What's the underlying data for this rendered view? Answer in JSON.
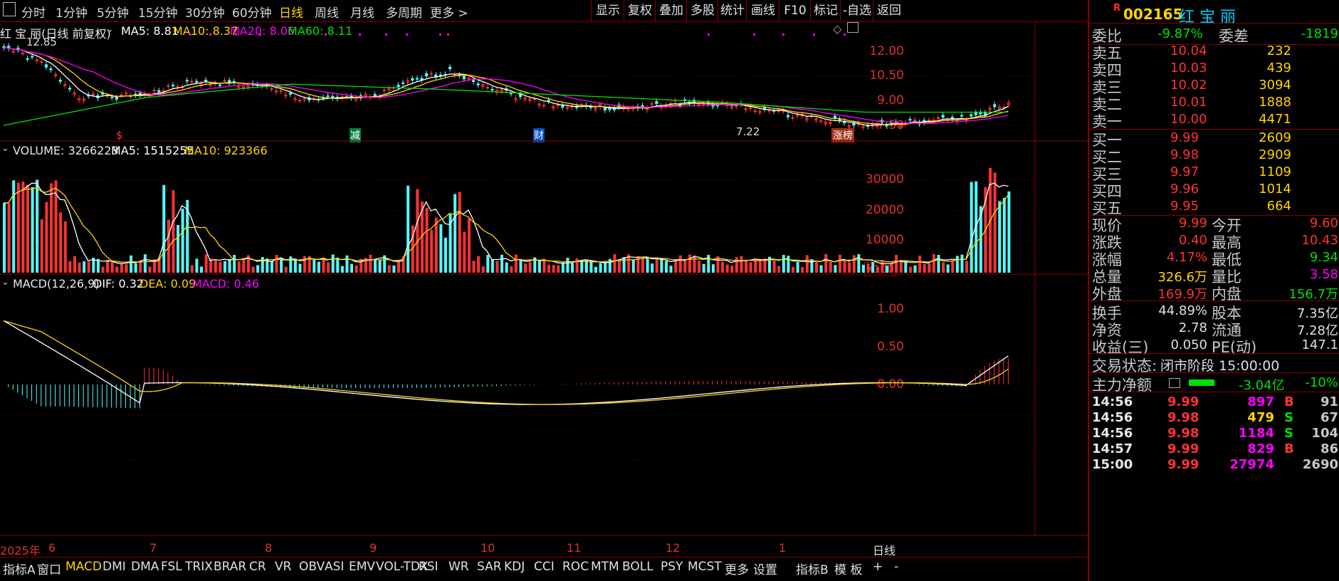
{
  "toolbar": {
    "icon": "panel-icon",
    "periods": [
      "分时",
      "1分钟",
      "5分钟",
      "15分钟",
      "30分钟",
      "60分钟",
      "日线",
      "周线",
      "月线",
      "多周期",
      "更多 >"
    ],
    "active_period": "日线",
    "right_buttons": [
      "显示",
      "复权",
      "叠加",
      "多股",
      "统计",
      "画线",
      "F10",
      "标记",
      "-自选",
      "返回"
    ]
  },
  "main_chart": {
    "stock_title": "红 宝 丽(日线 前复权)",
    "ma5": "MA5: 8.81",
    "ma10": "MA10: 8.37",
    "ma20": "MA20: 8.06",
    "ma60": "MA60: 8.11",
    "high_mark": "12.85",
    "low_mark": "7.22",
    "y_ticks": [
      "12.00",
      "10.50",
      "9.00",
      "7.50"
    ],
    "markers": {
      "s": "$",
      "reduce": "减",
      "finance": "财",
      "limit": "涨榜"
    },
    "colors": {
      "up": "#ff3232",
      "down": "#54fcfc",
      "ma5": "#ffffff",
      "ma10": "#ffd400",
      "ma20": "#ff00ff",
      "ma60": "#00e000"
    }
  },
  "volume_chart": {
    "title": "VOLUME: 3266223",
    "ma5": "MA5: 1515255",
    "ma10": "MA10: 923366",
    "y_ticks": [
      "30000",
      "20000",
      "10000"
    ],
    "unit": "X100"
  },
  "macd_chart": {
    "title": "MACD(12,26,9)",
    "dif": "DIF: 0.32",
    "dea": "DEA: 0.09",
    "macd": "MACD: 0.46",
    "y_ticks": [
      "1.00",
      "0.50",
      "0.00"
    ]
  },
  "date_axis": {
    "labels": [
      "2025年",
      "6",
      "7",
      "8",
      "9",
      "10",
      "11",
      "12",
      "1"
    ],
    "period_label": "日线"
  },
  "bottom_tabs": [
    "指标A",
    "窗口",
    "MACD",
    "DMI",
    "DMA",
    "FSL",
    "TRIX",
    "BRAR",
    "CR",
    "VR",
    "OBV",
    "ASI",
    "EMV",
    "VOL-TDX",
    "RSI",
    "WR",
    "SAR",
    "KDJ",
    "CCI",
    "ROC",
    "MTM",
    "BOLL",
    "PSY",
    "MCST",
    "更多",
    "设置",
    "指标B",
    "模 板",
    "+",
    "-"
  ],
  "bottom_active": "MACD",
  "quote_panel": {
    "badge": "R",
    "code": "002165",
    "name": "红 宝 丽",
    "weibi_label": "委比",
    "weibi_value": "-9.87%",
    "weicha_label": "委差",
    "weicha_value": "-1819",
    "asks": [
      {
        "label": "卖五",
        "price": "10.04",
        "vol": "232"
      },
      {
        "label": "卖四",
        "price": "10.03",
        "vol": "439"
      },
      {
        "label": "卖三",
        "price": "10.02",
        "vol": "3094"
      },
      {
        "label": "卖二",
        "price": "10.01",
        "vol": "1888"
      },
      {
        "label": "卖一",
        "price": "10.00",
        "vol": "4471"
      }
    ],
    "bids": [
      {
        "label": "买一",
        "price": "9.99",
        "vol": "2609"
      },
      {
        "label": "买二",
        "price": "9.98",
        "vol": "2909"
      },
      {
        "label": "买三",
        "price": "9.97",
        "vol": "1109"
      },
      {
        "label": "买四",
        "price": "9.96",
        "vol": "1014"
      },
      {
        "label": "买五",
        "price": "9.95",
        "vol": "664"
      }
    ],
    "stats": [
      {
        "l1": "现价",
        "v1": "9.99",
        "c1": "#ff3232",
        "l2": "今开",
        "v2": "9.60",
        "c2": "#ff3232"
      },
      {
        "l1": "涨跌",
        "v1": "0.40",
        "c1": "#ff3232",
        "l2": "最高",
        "v2": "10.43",
        "c2": "#ff3232"
      },
      {
        "l1": "涨幅",
        "v1": "4.17%",
        "c1": "#ff3232",
        "l2": "最低",
        "v2": "9.34",
        "c2": "#00e000"
      },
      {
        "l1": "总量",
        "v1": "326.6万",
        "c1": "#ffd400",
        "l2": "量比",
        "v2": "3.58",
        "c2": "#ff00ff"
      },
      {
        "l1": "外盘",
        "v1": "169.9万",
        "c1": "#ff3232",
        "l2": "内盘",
        "v2": "156.7万",
        "c2": "#00e000"
      }
    ],
    "stats2": [
      {
        "l1": "换手",
        "v1": "44.89%",
        "l2": "股本",
        "v2": "7.35亿"
      },
      {
        "l1": "净资",
        "v1": "2.78",
        "l2": "流通",
        "v2": "7.28亿"
      },
      {
        "l1": "收益(三)",
        "v1": "0.050",
        "l2": "PE(动)",
        "v2": "147.1"
      }
    ],
    "trade_status_label": "交易状态:",
    "trade_status": "闭市阶段 15:00:00",
    "main_flow_label": "主力净额",
    "main_flow_value": "-3.04亿",
    "main_flow_pct": "-10%",
    "ticks": [
      {
        "time": "14:56",
        "price": "9.99",
        "vol": "897",
        "vc": "#ff00ff",
        "side": "B",
        "n": "91"
      },
      {
        "time": "14:56",
        "price": "9.98",
        "vol": "479",
        "vc": "#ffd400",
        "side": "S",
        "n": "67"
      },
      {
        "time": "14:56",
        "price": "9.98",
        "vol": "1184",
        "vc": "#ff00ff",
        "side": "S",
        "n": "104"
      },
      {
        "time": "14:57",
        "price": "9.99",
        "vol": "829",
        "vc": "#ff00ff",
        "side": "B",
        "n": "86"
      },
      {
        "time": "15:00",
        "price": "9.99",
        "vol": "27974",
        "vc": "#ff00ff",
        "side": "",
        "n": "2690"
      }
    ]
  }
}
